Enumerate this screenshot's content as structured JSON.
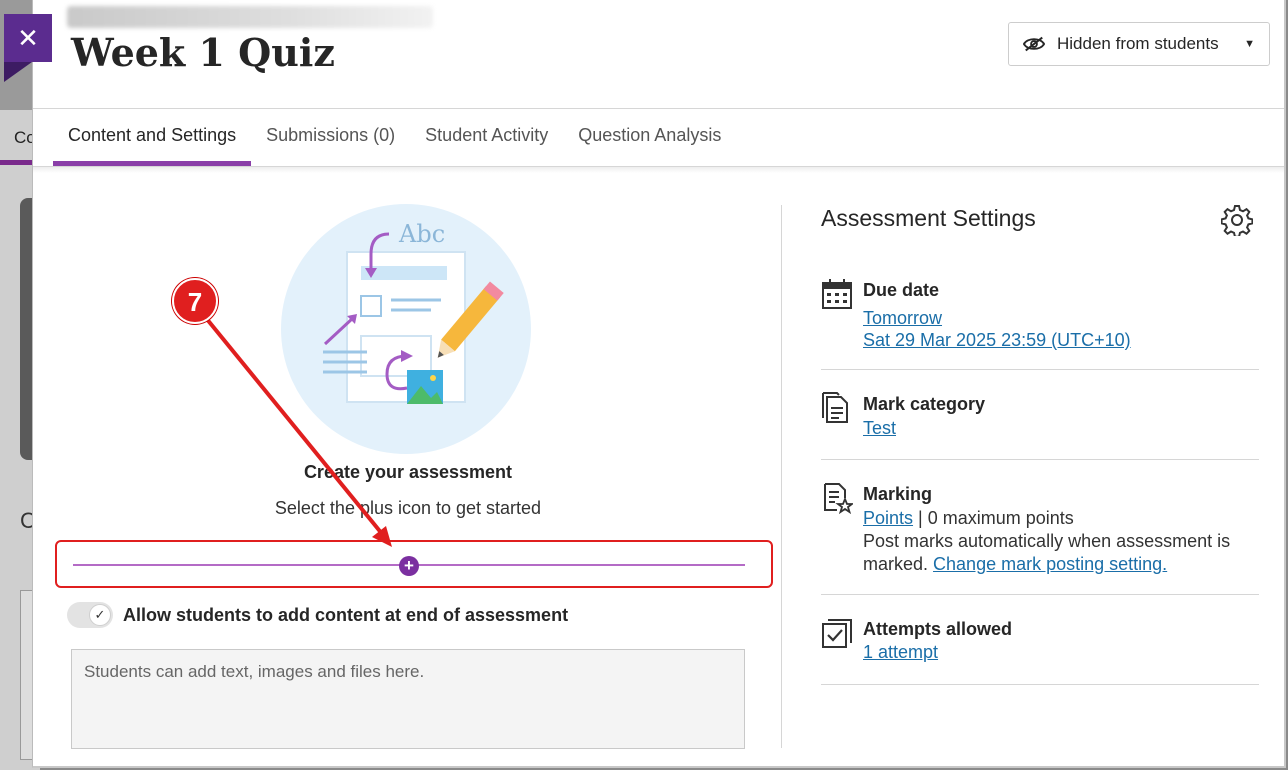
{
  "background": {
    "tab_fragment": "Co",
    "heading_fragment": "C"
  },
  "header": {
    "close_label": "✕",
    "title": "Week 1 Quiz",
    "visibility": {
      "label": "Hidden from students",
      "icon": "eye-slash-icon"
    }
  },
  "tabs": [
    {
      "label": "Content and Settings",
      "active": true
    },
    {
      "label": "Submissions (0)",
      "active": false
    },
    {
      "label": "Student Activity",
      "active": false
    },
    {
      "label": "Question Analysis",
      "active": false
    }
  ],
  "illustration": {
    "text": "Abc"
  },
  "create": {
    "title": "Create your assessment",
    "subtitle": "Select the plus icon to get started",
    "plus_label": "+"
  },
  "allow_students": {
    "label": "Allow students to add content at end of assessment",
    "toggle_on": true,
    "check": "✓"
  },
  "student_box": {
    "placeholder": "Students can add text, images and files here."
  },
  "settings": {
    "title": "Assessment Settings",
    "due_date": {
      "label": "Due date",
      "relative": "Tomorrow",
      "datetime": "Sat 29 Mar 2025 23:59 (UTC+10)"
    },
    "mark_category": {
      "label": "Mark category",
      "value": "Test"
    },
    "marking": {
      "label": "Marking",
      "scheme": "Points",
      "points_text": " | 0 maximum points",
      "post_text_1": "Post marks automatically when assessment is",
      "post_text_2": "marked. ",
      "change_link": "Change mark posting setting."
    },
    "attempts": {
      "label": "Attempts allowed",
      "value": "1 attempt"
    }
  },
  "annotation": {
    "step_number": "7",
    "color": "#e01f1f"
  },
  "colors": {
    "accent": "#8a3ea8",
    "link": "#1a6ea8",
    "close_bg": "#5b2c8f"
  }
}
